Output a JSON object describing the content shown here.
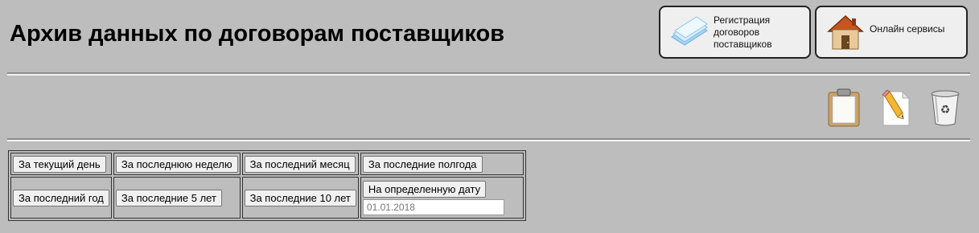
{
  "page": {
    "title": "Архив данных по договорам поставщиков"
  },
  "nav": {
    "registration": {
      "icon": "registration-sheets-icon",
      "label": "Регистрация договоров поставщиков"
    },
    "online": {
      "icon": "house-icon",
      "label": "Онлайн сервисы"
    }
  },
  "toolbar": {
    "clipboard_icon": "clipboard-icon",
    "edit_icon": "pencil-document-icon",
    "trash_icon": "recycle-bin-icon"
  },
  "periods": {
    "row1": [
      "За текущий день",
      "За последнюю неделю",
      "За последний месяц",
      "За последние полгода"
    ],
    "row2": [
      "За последний год",
      "За последние 5 лет",
      "За последние 10 лет",
      "На определенную дату"
    ],
    "date_value": "01.01.2018"
  },
  "colors": {
    "background": "#bdbdbd",
    "button_bg": "#efefef"
  }
}
